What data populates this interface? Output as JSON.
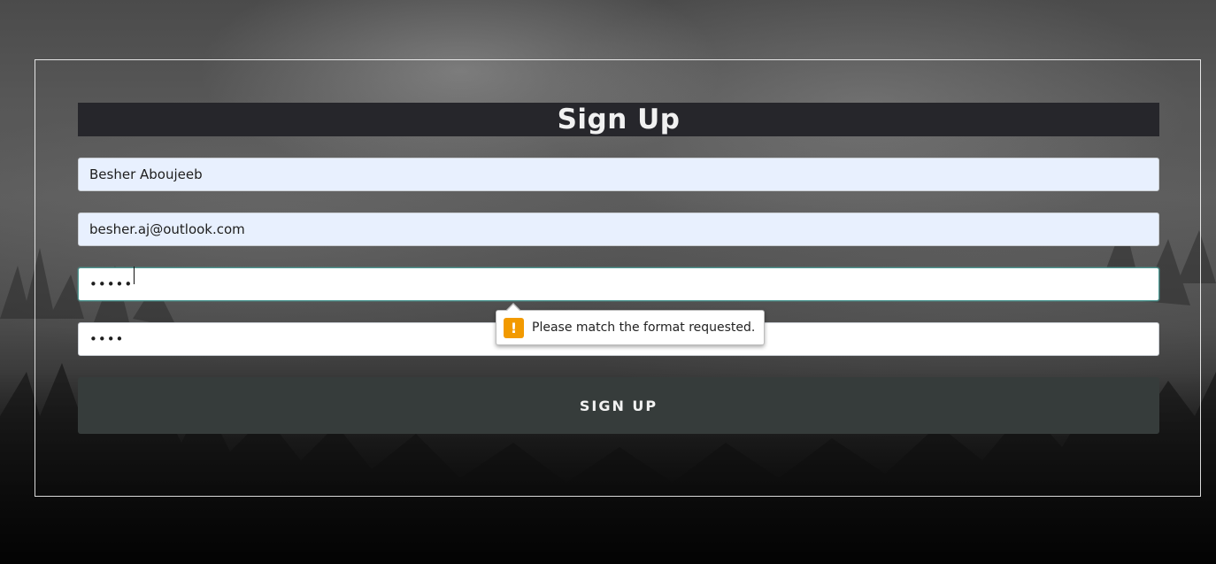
{
  "form": {
    "title": "Sign Up",
    "name_value": "Besher Aboujeeb",
    "email_value": "besher.aj@outlook.com",
    "password_masked": "•••••",
    "confirm_password_masked": "••••",
    "submit_label": "SIGN UP"
  },
  "validation": {
    "message": "Please match the format requested.",
    "icon": "warning-icon",
    "icon_glyph": "!",
    "icon_color": "#f29a00"
  },
  "colors": {
    "title_bar": "#26262b",
    "submit_button": "#363c3b",
    "autofill_field": "#e8f0fe",
    "focus_border": "#4f9a94"
  }
}
